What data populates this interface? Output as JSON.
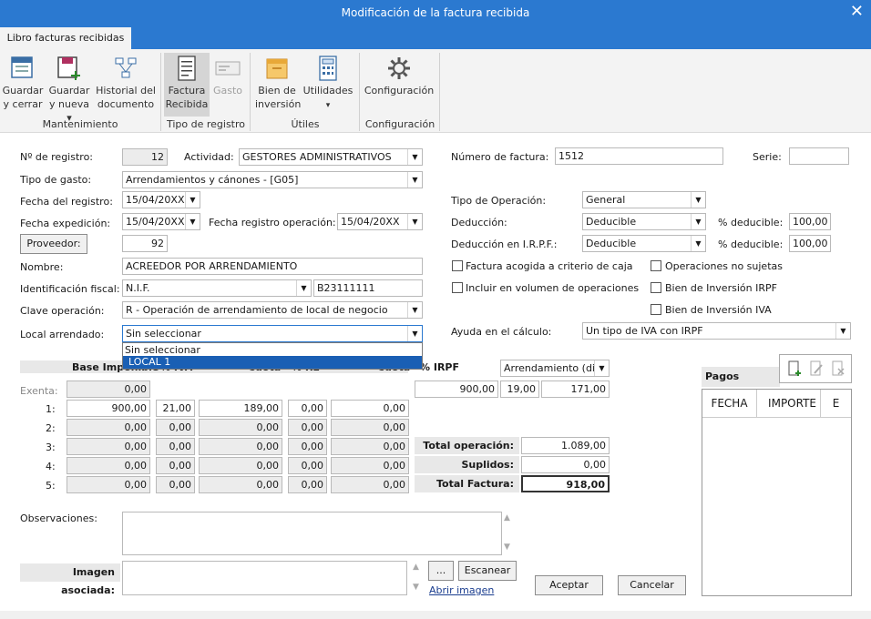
{
  "window": {
    "title": "Modificación de la factura recibida",
    "close": "✕"
  },
  "tabs": {
    "active": "Libro facturas recibidas"
  },
  "ribbon": {
    "guardar_cerrar": [
      "Guardar",
      "y cerrar"
    ],
    "guardar_nueva": [
      "Guardar",
      "y nueva ▾"
    ],
    "historial": [
      "Historial del",
      "documento"
    ],
    "factura_recibida": [
      "Factura",
      "Recibida"
    ],
    "gasto": "Gasto",
    "bien_inversion": [
      "Bien de",
      "inversión"
    ],
    "utilidades": [
      "Utilidades",
      "▾"
    ],
    "configuracion": "Configuración",
    "groups": {
      "mantenimiento": "Mantenimiento",
      "tipo_registro": "Tipo de registro",
      "utiles": "Útiles",
      "configuracion": "Configuración"
    }
  },
  "form": {
    "n_registro_label": "Nº de registro:",
    "n_registro": "12",
    "actividad_label": "Actividad:",
    "actividad": "GESTORES ADMINISTRATIVOS",
    "tipo_gasto_label": "Tipo de gasto:",
    "tipo_gasto": "Arrendamientos y cánones - [G05]",
    "fecha_registro_label": "Fecha del registro:",
    "fecha_registro": "15/04/20XX",
    "fecha_expedicion_label": "Fecha expedición:",
    "fecha_expedicion": "15/04/20XX",
    "fecha_reg_op_label": "Fecha registro operación:",
    "fecha_reg_op": "15/04/20XX",
    "proveedor_button": "Proveedor:",
    "proveedor": "92",
    "nombre_label": "Nombre:",
    "nombre": "ACREEDOR POR ARRENDAMIENTO",
    "id_fiscal_label": "Identificación fiscal:",
    "id_fiscal_tipo": "N.I.F.",
    "id_fiscal": "B23111111",
    "clave_op_label": "Clave operación:",
    "clave_op": "R - Operación de arrendamiento de local de negocio",
    "local_label": "Local arrendado:",
    "local": "Sin seleccionar",
    "local_options": [
      "Sin seleccionar",
      "LOCAL 1"
    ],
    "num_factura_label": "Número de factura:",
    "num_factura": "1512",
    "serie_label": "Serie:",
    "serie": "",
    "tipo_op_label": "Tipo de Operación:",
    "tipo_op": "General",
    "deduccion_label": "Deducción:",
    "deduccion": "Deducible",
    "pct_deducible_label": "% deducible:",
    "pct_deducible": "100,00",
    "deduccion_irpf_label": "Deducción en I.R.P.F.:",
    "deduccion_irpf": "Deducible",
    "pct_deducible2": "100,00",
    "chk_caja": "Factura acogida a criterio de caja",
    "chk_no_sujetas": "Operaciones no sujetas",
    "chk_volumen": "Incluir en  volumen de operaciones",
    "chk_bien_irpf": "Bien de Inversión IRPF",
    "chk_bien_iva": "Bien de Inversión IVA",
    "ayuda_label": "Ayuda en el cálculo:",
    "ayuda": "Un tipo de IVA con IRPF"
  },
  "grid": {
    "headers": {
      "base": "Base Imponible",
      "iva": "% IVA",
      "cuota": "Cuota",
      "re": "% RE",
      "cuota_re": "Cuota",
      "irpf": "% IRPF"
    },
    "exenta_label": "Exenta:",
    "exenta": "0,00",
    "rows": [
      {
        "n": "1:",
        "base": "900,00",
        "iva": "21,00",
        "cuota": "189,00",
        "re": "0,00",
        "cuota_re": "0,00"
      },
      {
        "n": "2:",
        "base": "0,00",
        "iva": "0,00",
        "cuota": "0,00",
        "re": "0,00",
        "cuota_re": "0,00"
      },
      {
        "n": "3:",
        "base": "0,00",
        "iva": "0,00",
        "cuota": "0,00",
        "re": "0,00",
        "cuota_re": "0,00"
      },
      {
        "n": "4:",
        "base": "0,00",
        "iva": "0,00",
        "cuota": "0,00",
        "re": "0,00",
        "cuota_re": "0,00"
      },
      {
        "n": "5:",
        "base": "0,00",
        "iva": "0,00",
        "cuota": "0,00",
        "re": "0,00",
        "cuota_re": "0,00"
      }
    ],
    "irpf_tipo": "Arrendamiento (dir",
    "irpf_base": "900,00",
    "irpf_pct": "19,00",
    "irpf_cuota": "171,00",
    "total_op_label": "Total operación:",
    "total_op": "1.089,00",
    "suplidos_label": "Suplidos:",
    "suplidos": "0,00",
    "total_fac_label": "Total Factura:",
    "total_fac": "918,00"
  },
  "pagos": {
    "title": "Pagos",
    "cols": [
      "FECHA",
      "IMPORTE",
      "E"
    ]
  },
  "footer": {
    "observaciones_label": "Observaciones:",
    "imagen_label": "Imagen asociada:",
    "dots": "...",
    "escanear": "Escanear",
    "abrir": "Abrir imagen",
    "aceptar": "Aceptar",
    "cancelar": "Cancelar"
  }
}
